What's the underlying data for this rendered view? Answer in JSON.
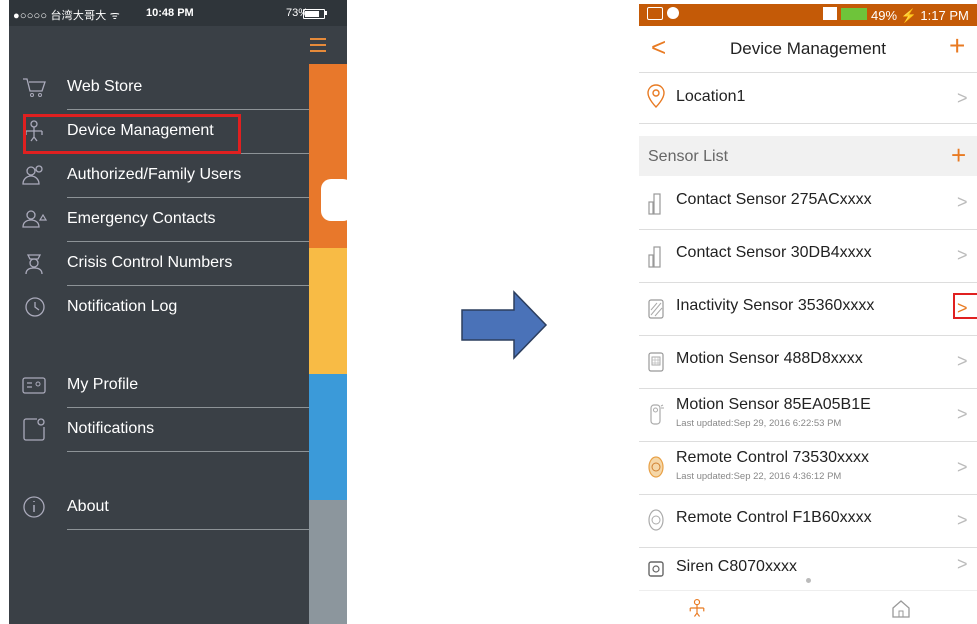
{
  "left_phone": {
    "status_bar": {
      "carrier": "●○○○○ 台湾大哥大 ᯤ",
      "time": "10:48 PM",
      "battery": "73%"
    },
    "menu": [
      {
        "label": "Web Store",
        "icon": "cart-icon"
      },
      {
        "label": "Device Management",
        "icon": "device-tree-icon"
      },
      {
        "label": "Authorized/Family Users",
        "icon": "users-icon"
      },
      {
        "label": "Emergency Contacts",
        "icon": "emergency-contact-icon"
      },
      {
        "label": "Crisis Control Numbers",
        "icon": "officer-icon"
      },
      {
        "label": "Notification Log",
        "icon": "history-clock-icon"
      },
      {
        "label": "My Profile",
        "icon": "profile-card-icon"
      },
      {
        "label": "Notifications",
        "icon": "notification-icon"
      },
      {
        "label": "About",
        "icon": "info-icon"
      }
    ],
    "strip_colors": [
      "#e8782b",
      "#f8bb45",
      "#3b9ad9",
      "#8c969d"
    ]
  },
  "right_phone": {
    "status_bar": {
      "text": "49% ⚡ 1:17 PM"
    },
    "header": {
      "title": "Device Management",
      "back": "<",
      "add": "+"
    },
    "location": {
      "label": "Location1"
    },
    "sensor_list": {
      "title": "Sensor List",
      "add": "+",
      "items": [
        {
          "name": "Contact Sensor 275ACxxxx",
          "sub": ""
        },
        {
          "name": "Contact Sensor 30DB4xxxx",
          "sub": ""
        },
        {
          "name": "Inactivity Sensor 35360xxxx",
          "sub": ""
        },
        {
          "name": "Motion Sensor 488D8xxxx",
          "sub": ""
        },
        {
          "name": "Motion Sensor 85EA05B1E",
          "sub": "Last updated:Sep 29, 2016 6:22:53 PM"
        },
        {
          "name": "Remote Control 73530xxxx",
          "sub": "Last updated:Sep 22, 2016 4:36:12 PM"
        },
        {
          "name": "Remote Control F1B60xxxx",
          "sub": ""
        },
        {
          "name": "Siren C8070xxxx",
          "sub": ""
        }
      ]
    },
    "chevron": ">"
  },
  "colors": {
    "accent": "#e87a22",
    "highlight": "#e02020",
    "drawer_bg": "#3a4046",
    "arrow_fill": "#4a72b8"
  }
}
